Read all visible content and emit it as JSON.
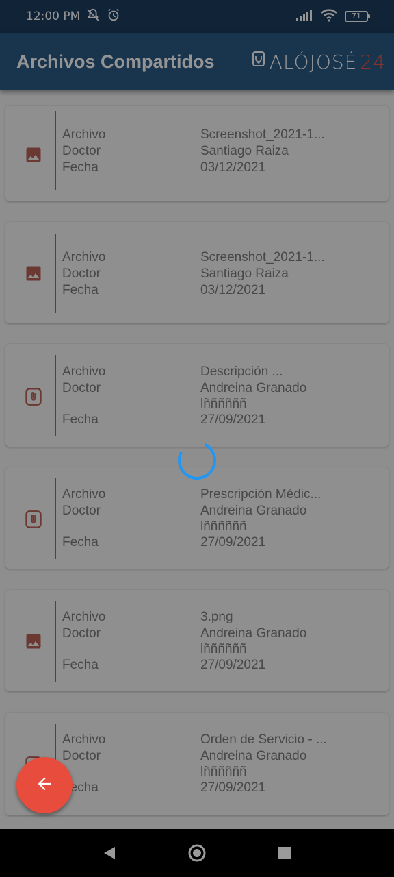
{
  "status_bar": {
    "time": "12:00 PM",
    "battery": "71"
  },
  "app_bar": {
    "title": "Archivos Compartidos",
    "logo_text": "ALÓJOSÉ",
    "logo_number": "24"
  },
  "labels": {
    "archivo": "Archivo",
    "doctor": "Doctor",
    "fecha": "Fecha"
  },
  "files": [
    {
      "icon": "image-icon",
      "archivo": "Screenshot_2021-1...",
      "doctor": "Santiago Raiza",
      "doctor_extra": "",
      "fecha": "03/12/2021"
    },
    {
      "icon": "image-icon",
      "archivo": "Screenshot_2021-1...",
      "doctor": "Santiago Raiza",
      "doctor_extra": "",
      "fecha": "03/12/2021"
    },
    {
      "icon": "attachment-icon",
      "archivo": "Descripción ...",
      "doctor": "Andreina Granado",
      "doctor_extra": "lññññññ",
      "fecha": "27/09/2021"
    },
    {
      "icon": "attachment-icon",
      "archivo": "Prescripción Médic...",
      "doctor": "Andreina Granado",
      "doctor_extra": "lññññññ",
      "fecha": "27/09/2021"
    },
    {
      "icon": "image-icon",
      "archivo": "3.png",
      "doctor": "Andreina Granado",
      "doctor_extra": "lññññññ",
      "fecha": "27/09/2021"
    },
    {
      "icon": "attachment-icon",
      "archivo": "Orden de Servicio - ...",
      "doctor": "Andreina Granado",
      "doctor_extra": "lññññññ",
      "fecha": "27/09/2021"
    }
  ],
  "colors": {
    "status_bar": "#1c3d5f",
    "app_bar": "#2c5a86",
    "accent": "#e84c3d",
    "spinner": "#2196f3"
  },
  "loading": true
}
